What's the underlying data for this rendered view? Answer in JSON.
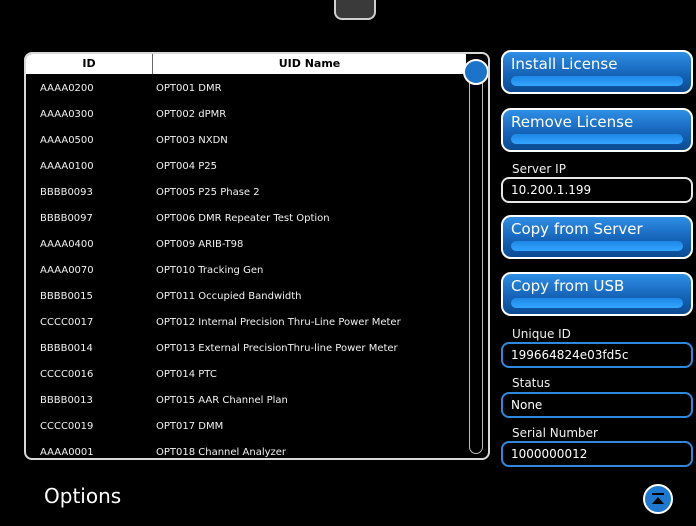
{
  "table": {
    "headers": {
      "id": "ID",
      "uid_name": "UID Name"
    },
    "rows": [
      {
        "id": "AAAA0200",
        "uid_name": "OPT001 DMR"
      },
      {
        "id": "AAAA0300",
        "uid_name": "OPT002 dPMR"
      },
      {
        "id": "AAAA0500",
        "uid_name": "OPT003 NXDN"
      },
      {
        "id": "AAAA0100",
        "uid_name": "OPT004 P25"
      },
      {
        "id": "BBBB0093",
        "uid_name": "OPT005 P25 Phase 2"
      },
      {
        "id": "BBBB0097",
        "uid_name": "OPT006 DMR Repeater Test Option"
      },
      {
        "id": "AAAA0400",
        "uid_name": "OPT009 ARIB-T98"
      },
      {
        "id": "AAAA0070",
        "uid_name": "OPT010 Tracking Gen"
      },
      {
        "id": "BBBB0015",
        "uid_name": "OPT011 Occupied Bandwidth"
      },
      {
        "id": "CCCC0017",
        "uid_name": "OPT012 Internal Precision Thru-Line Power Meter"
      },
      {
        "id": "BBBB0014",
        "uid_name": "OPT013 External PrecisionThru-line Power Meter"
      },
      {
        "id": "CCCC0016",
        "uid_name": "OPT014 PTC"
      },
      {
        "id": "BBBB0013",
        "uid_name": "OPT015 AAR Channel Plan"
      },
      {
        "id": "CCCC0019",
        "uid_name": "OPT017 DMM"
      },
      {
        "id": "AAAA0001",
        "uid_name": "OPT018 Channel Analyzer"
      }
    ]
  },
  "buttons": {
    "install": "Install License",
    "remove": "Remove License",
    "copy_server": "Copy from Server",
    "copy_usb": "Copy from USB"
  },
  "fields": {
    "server_ip": {
      "label": "Server IP",
      "value": "10.200.1.199"
    },
    "unique_id": {
      "label": "Unique ID",
      "value": "199664824e03fd5c"
    },
    "status": {
      "label": "Status",
      "value": "None"
    },
    "serial_number": {
      "label": "Serial Number",
      "value": "1000000012"
    }
  },
  "page": {
    "title": "Options"
  },
  "icons": {
    "scroll_top": "scroll-to-top-icon"
  },
  "colors": {
    "accent": "#1b74c9",
    "button_top": "#2f8fe6",
    "button_bottom": "#0d4a92"
  }
}
